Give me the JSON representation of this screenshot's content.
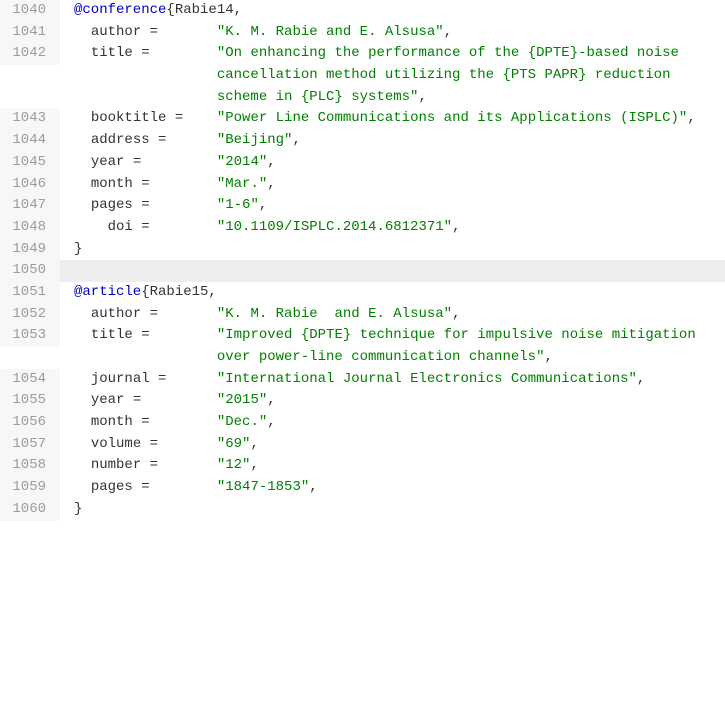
{
  "lines": [
    {
      "num": "1040",
      "highlight": false,
      "segments": [
        {
          "cls": "entrytype",
          "text": "@conference"
        },
        {
          "cls": "plain",
          "text": "{Rabie14,"
        }
      ]
    },
    {
      "num": "1041",
      "highlight": false,
      "segments": [
        {
          "cls": "plain",
          "text": "  author =       "
        },
        {
          "cls": "str",
          "text": "\"K. M. Rabie and E. Alsusa\""
        },
        {
          "cls": "plain",
          "text": ","
        }
      ]
    },
    {
      "num": "1042",
      "highlight": false,
      "segments": [
        {
          "cls": "plain",
          "text": "  title =        "
        },
        {
          "cls": "str",
          "text": "\"On enhancing the performance of the {DPTE}-based noise cancellation method utilizing the {PTS PAPR} reduction scheme in {PLC} systems\""
        },
        {
          "cls": "plain",
          "text": ","
        }
      ]
    },
    {
      "num": "1043",
      "highlight": false,
      "segments": [
        {
          "cls": "plain",
          "text": "  booktitle =    "
        },
        {
          "cls": "str",
          "text": "\"Power Line Communications and its Applications (ISPLC)\""
        },
        {
          "cls": "plain",
          "text": ","
        }
      ]
    },
    {
      "num": "1044",
      "highlight": false,
      "segments": [
        {
          "cls": "plain",
          "text": "  address =      "
        },
        {
          "cls": "str",
          "text": "\"Beijing\""
        },
        {
          "cls": "plain",
          "text": ","
        }
      ]
    },
    {
      "num": "1045",
      "highlight": false,
      "segments": [
        {
          "cls": "plain",
          "text": "  year =         "
        },
        {
          "cls": "str",
          "text": "\"2014\""
        },
        {
          "cls": "plain",
          "text": ","
        }
      ]
    },
    {
      "num": "1046",
      "highlight": false,
      "segments": [
        {
          "cls": "plain",
          "text": "  month =        "
        },
        {
          "cls": "str",
          "text": "\"Mar.\""
        },
        {
          "cls": "plain",
          "text": ","
        }
      ]
    },
    {
      "num": "1047",
      "highlight": false,
      "segments": [
        {
          "cls": "plain",
          "text": "  pages =        "
        },
        {
          "cls": "str",
          "text": "\"1-6\""
        },
        {
          "cls": "plain",
          "text": ","
        }
      ]
    },
    {
      "num": "1048",
      "highlight": false,
      "segments": [
        {
          "cls": "plain",
          "text": "    doi =        "
        },
        {
          "cls": "str",
          "text": "\"10.1109/ISPLC.2014.6812371\""
        },
        {
          "cls": "plain",
          "text": ","
        }
      ]
    },
    {
      "num": "1049",
      "highlight": false,
      "segments": [
        {
          "cls": "plain",
          "text": "}"
        }
      ]
    },
    {
      "num": "1050",
      "highlight": true,
      "segments": [
        {
          "cls": "plain",
          "text": ""
        }
      ]
    },
    {
      "num": "1051",
      "highlight": false,
      "segments": [
        {
          "cls": "entrytype",
          "text": "@article"
        },
        {
          "cls": "plain",
          "text": "{Rabie15,"
        }
      ]
    },
    {
      "num": "1052",
      "highlight": false,
      "segments": [
        {
          "cls": "plain",
          "text": "  author =       "
        },
        {
          "cls": "str",
          "text": "\"K. M. Rabie  and E. Alsusa\""
        },
        {
          "cls": "plain",
          "text": ","
        }
      ]
    },
    {
      "num": "1053",
      "highlight": false,
      "segments": [
        {
          "cls": "plain",
          "text": "  title =        "
        },
        {
          "cls": "str",
          "text": "\"Improved {DPTE} technique for impulsive noise mitigation over power-line communication channels\""
        },
        {
          "cls": "plain",
          "text": ","
        }
      ]
    },
    {
      "num": "1054",
      "highlight": false,
      "segments": [
        {
          "cls": "plain",
          "text": "  journal =      "
        },
        {
          "cls": "str",
          "text": "\"International Journal Electronics Communications\""
        },
        {
          "cls": "plain",
          "text": ","
        }
      ]
    },
    {
      "num": "1055",
      "highlight": false,
      "segments": [
        {
          "cls": "plain",
          "text": "  year =         "
        },
        {
          "cls": "str",
          "text": "\"2015\""
        },
        {
          "cls": "plain",
          "text": ","
        }
      ]
    },
    {
      "num": "1056",
      "highlight": false,
      "segments": [
        {
          "cls": "plain",
          "text": "  month =        "
        },
        {
          "cls": "str",
          "text": "\"Dec.\""
        },
        {
          "cls": "plain",
          "text": ","
        }
      ]
    },
    {
      "num": "1057",
      "highlight": false,
      "segments": [
        {
          "cls": "plain",
          "text": "  volume =       "
        },
        {
          "cls": "str",
          "text": "\"69\""
        },
        {
          "cls": "plain",
          "text": ","
        }
      ]
    },
    {
      "num": "1058",
      "highlight": false,
      "segments": [
        {
          "cls": "plain",
          "text": "  number =       "
        },
        {
          "cls": "str",
          "text": "\"12\""
        },
        {
          "cls": "plain",
          "text": ","
        }
      ]
    },
    {
      "num": "1059",
      "highlight": false,
      "segments": [
        {
          "cls": "plain",
          "text": "  pages =        "
        },
        {
          "cls": "str",
          "text": "\"1847-1853\""
        },
        {
          "cls": "plain",
          "text": ","
        }
      ]
    },
    {
      "num": "1060",
      "highlight": false,
      "segments": [
        {
          "cls": "plain",
          "text": "}"
        }
      ]
    }
  ]
}
